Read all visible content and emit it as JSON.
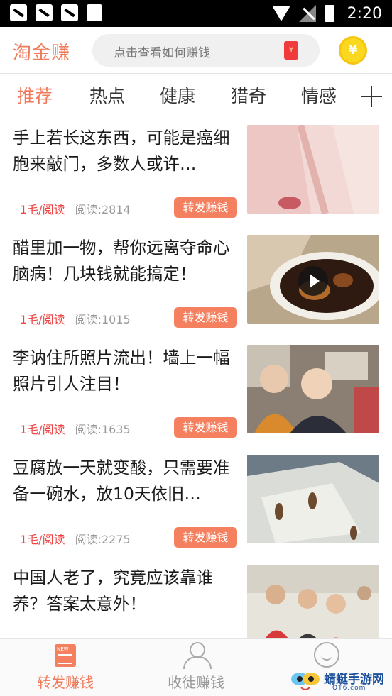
{
  "status_bar": {
    "time": "2:20"
  },
  "header": {
    "app_name": "淘金赚",
    "search_placeholder": "点击查看如何赚钱",
    "coin_symbol": "¥"
  },
  "tabs": [
    {
      "label": "推荐",
      "active": true
    },
    {
      "label": "热点",
      "active": false
    },
    {
      "label": "健康",
      "active": false
    },
    {
      "label": "猎奇",
      "active": false
    },
    {
      "label": "情感",
      "active": false
    }
  ],
  "feed": [
    {
      "title": "手上若长这东西，可能是癌细胞来敲门，多数人或许…",
      "price": "1毛/阅读",
      "reads": "阅读:2814",
      "share_label": "转发赚钱",
      "video": false
    },
    {
      "title": "醋里加一物，帮你远离夺命心脑病！几块钱就能搞定！",
      "price": "1毛/阅读",
      "reads": "阅读:1015",
      "share_label": "转发赚钱",
      "video": true
    },
    {
      "title": "李讷住所照片流出！墙上一幅照片引人注目！",
      "price": "1毛/阅读",
      "reads": "阅读:1635",
      "share_label": "转发赚钱",
      "video": false
    },
    {
      "title": "豆腐放一天就变酸，只需要准备一碗水，放10天依旧…",
      "price": "1毛/阅读",
      "reads": "阅读:2275",
      "share_label": "转发赚钱",
      "video": false
    },
    {
      "title": "中国人老了，究竟应该靠谁养？答案太意外！",
      "video": false
    }
  ],
  "bottom_nav": [
    {
      "label": "转发赚钱",
      "active": true,
      "icon": "news-icon"
    },
    {
      "label": "收徒赚钱",
      "active": false,
      "icon": "person-icon"
    },
    {
      "label": "",
      "active": false,
      "icon": "smile-icon"
    }
  ],
  "watermark": {
    "text": "蜻蜓手游网",
    "url": "QT6.com"
  },
  "colors": {
    "accent": "#f07a5a",
    "share_button": "#f4805f",
    "price": "#ee4444"
  }
}
